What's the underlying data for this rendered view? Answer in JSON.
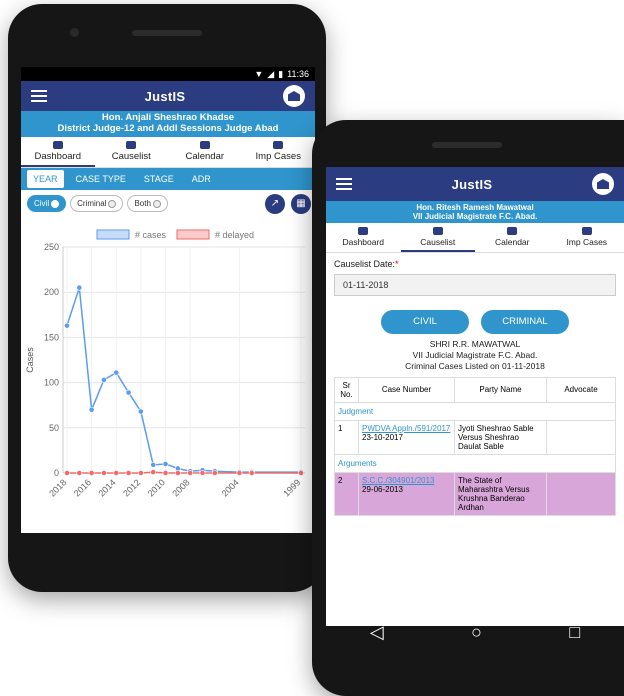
{
  "status": {
    "time": "11:36"
  },
  "dashboard": {
    "app_title": "JustIS",
    "judge_name": "Hon. Anjali Sheshrao Khadse",
    "judge_designation": "District Judge-12 and Addl Sessions Judge Abad",
    "tabs": [
      {
        "label": "Dashboard",
        "active": true
      },
      {
        "label": "Causelist"
      },
      {
        "label": "Calendar"
      },
      {
        "label": "Imp Cases"
      }
    ],
    "subtabs": [
      {
        "label": "YEAR",
        "active": true
      },
      {
        "label": "CASE TYPE"
      },
      {
        "label": "STAGE"
      },
      {
        "label": "ADR"
      }
    ],
    "filters": [
      {
        "label": "Civil",
        "selected": true
      },
      {
        "label": "Criminal"
      },
      {
        "label": "Both"
      }
    ],
    "icons": {
      "chart": "line-chart-icon",
      "grid": "grid-icon"
    }
  },
  "chart_data": {
    "type": "line",
    "ylabel": "Cases",
    "ylim": [
      0,
      250
    ],
    "yticks": [
      0,
      50,
      100,
      150,
      200,
      250
    ],
    "xtick_labels": [
      "2018",
      "2016",
      "2014",
      "2012",
      "2010",
      "2008",
      "2004",
      "1999"
    ],
    "legend_position": "top",
    "grid": true,
    "series": [
      {
        "name": "# cases",
        "color": "#5b9bf0",
        "x": [
          "2018",
          "2017",
          "2016",
          "2015",
          "2014",
          "2013",
          "2012",
          "2011",
          "2010",
          "2009",
          "2008",
          "2007",
          "2006",
          "2004",
          "2003",
          "1999"
        ],
        "values": [
          163,
          205,
          70,
          103,
          111,
          89,
          68,
          9,
          10,
          5,
          2,
          3,
          2,
          1,
          1,
          1
        ]
      },
      {
        "name": "# delayed",
        "color": "#f06b6b",
        "x": [
          "2018",
          "2017",
          "2016",
          "2015",
          "2014",
          "2013",
          "2012",
          "2011",
          "2010",
          "2009",
          "2008",
          "2007",
          "2006",
          "2004",
          "2003",
          "1999"
        ],
        "values": [
          0,
          0,
          0,
          0,
          0,
          0,
          0,
          1,
          0,
          0,
          0,
          0,
          0,
          0,
          0,
          0
        ]
      }
    ]
  },
  "causelist": {
    "app_title": "JustIS",
    "judge_name": "Hon. Ritesh Ramesh Mawatwal",
    "judge_designation": "VII Judicial Magistrate F.C. Abad.",
    "tabs": [
      {
        "label": "Dashboard"
      },
      {
        "label": "Causelist",
        "active": true
      },
      {
        "label": "Calendar"
      },
      {
        "label": "Imp Cases"
      }
    ],
    "date_label": "Causelist Date:",
    "date_value": "01-11-2018",
    "civil_label": "CIVIL",
    "criminal_label": "CRIMINAL",
    "caption_line1": "SHRI R.R. MAWATWAL",
    "caption_line2": "VII Judicial Magistrate F.C. Abad.",
    "caption_line3": "Criminal Cases Listed on 01-11-2018",
    "columns": [
      "Sr No.",
      "Case Number",
      "Party Name",
      "Advocate"
    ],
    "groups": [
      {
        "name": "Judgment",
        "rows": [
          {
            "sr": "1",
            "case_no": "PWDVA Appln./591/2017",
            "date": "23-10-2017",
            "party": "Jyoti Sheshrao Sable Versus Sheshrao Daulat Sable",
            "advocate": ""
          }
        ]
      },
      {
        "name": "Arguments",
        "rows": [
          {
            "sr": "2",
            "case_no": "S.C.C./304901/2013",
            "date": "29-06-2013",
            "party": "The State of Maharashtra Versus Krushna Banderao Ardhan",
            "advocate": ""
          }
        ]
      }
    ]
  }
}
